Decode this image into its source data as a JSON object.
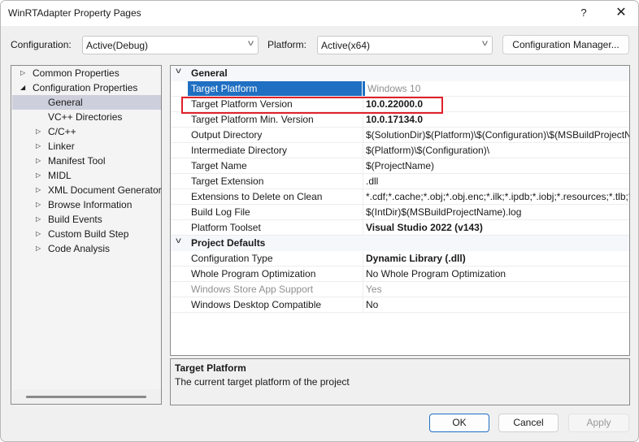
{
  "window": {
    "title": "WinRTAdapter Property Pages",
    "help_label": "?",
    "close_label": "✕"
  },
  "toolbar": {
    "configuration_label": "Configuration:",
    "configuration_value": "Active(Debug)",
    "platform_label": "Platform:",
    "platform_value": "Active(x64)",
    "config_manager_label": "Configuration Manager..."
  },
  "tree": {
    "items": [
      {
        "label": "Common Properties",
        "arrow": "▷"
      },
      {
        "label": "Configuration Properties",
        "arrow": "◢"
      },
      {
        "label": "General",
        "arrow": ""
      },
      {
        "label": "VC++ Directories",
        "arrow": ""
      },
      {
        "label": "C/C++",
        "arrow": "▷"
      },
      {
        "label": "Linker",
        "arrow": "▷"
      },
      {
        "label": "Manifest Tool",
        "arrow": "▷"
      },
      {
        "label": "MIDL",
        "arrow": "▷"
      },
      {
        "label": "XML Document Generator",
        "arrow": "▷"
      },
      {
        "label": "Browse Information",
        "arrow": "▷"
      },
      {
        "label": "Build Events",
        "arrow": "▷"
      },
      {
        "label": "Custom Build Step",
        "arrow": "▷"
      },
      {
        "label": "Code Analysis",
        "arrow": "▷"
      }
    ],
    "selected": "General"
  },
  "grid": {
    "categories": [
      {
        "name": "General",
        "properties": [
          {
            "name": "Target Platform",
            "value": "Windows 10"
          },
          {
            "name": "Target Platform Version",
            "value": "10.0.22000.0"
          },
          {
            "name": "Target Platform Min. Version",
            "value": "10.0.17134.0"
          },
          {
            "name": "Output Directory",
            "value": "$(SolutionDir)$(Platform)\\$(Configuration)\\$(MSBuildProjectName)\\"
          },
          {
            "name": "Intermediate Directory",
            "value": "$(Platform)\\$(Configuration)\\"
          },
          {
            "name": "Target Name",
            "value": "$(ProjectName)"
          },
          {
            "name": "Target Extension",
            "value": ".dll"
          },
          {
            "name": "Extensions to Delete on Clean",
            "value": "*.cdf;*.cache;*.obj;*.obj.enc;*.ilk;*.ipdb;*.iobj;*.resources;*.tlb;*.tli;"
          },
          {
            "name": "Build Log File",
            "value": "$(IntDir)$(MSBuildProjectName).log"
          },
          {
            "name": "Platform Toolset",
            "value": "Visual Studio 2022 (v143)"
          }
        ]
      },
      {
        "name": "Project Defaults",
        "properties": [
          {
            "name": "Configuration Type",
            "value": "Dynamic Library (.dll)"
          },
          {
            "name": "Whole Program Optimization",
            "value": "No Whole Program Optimization"
          },
          {
            "name": "Windows Store App Support",
            "value": "Yes"
          },
          {
            "name": "Windows Desktop Compatible",
            "value": "No"
          }
        ]
      }
    ],
    "selected_property": "Target Platform",
    "highlighted_property": "Target Platform Version",
    "highlight_color": "#e0202a",
    "selection_color": "#1f6fc2"
  },
  "description": {
    "title": "Target Platform",
    "text": "The current target platform of the project"
  },
  "buttons": {
    "ok": "OK",
    "cancel": "Cancel",
    "apply": "Apply"
  }
}
